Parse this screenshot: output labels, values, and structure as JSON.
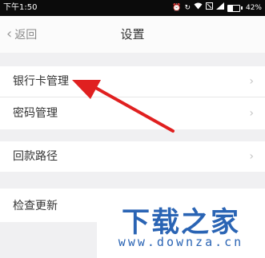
{
  "status_bar": {
    "time": "下午1:50",
    "battery_percent": "42%",
    "battery_level": 0.42,
    "icons": [
      "alarm-icon",
      "wifi-icon",
      "sim-icon",
      "signal-icon",
      "battery-icon"
    ]
  },
  "header": {
    "back_label": "返回",
    "title": "设置"
  },
  "settings": {
    "items": [
      {
        "label": "银行卡管理"
      },
      {
        "label": "密码管理"
      },
      {
        "label": "回款路径"
      },
      {
        "label": "检查更新"
      }
    ]
  },
  "watermark": {
    "main": "下载之家",
    "url": "www.downza.cn"
  },
  "annotation": {
    "arrow_color": "#e02020"
  }
}
